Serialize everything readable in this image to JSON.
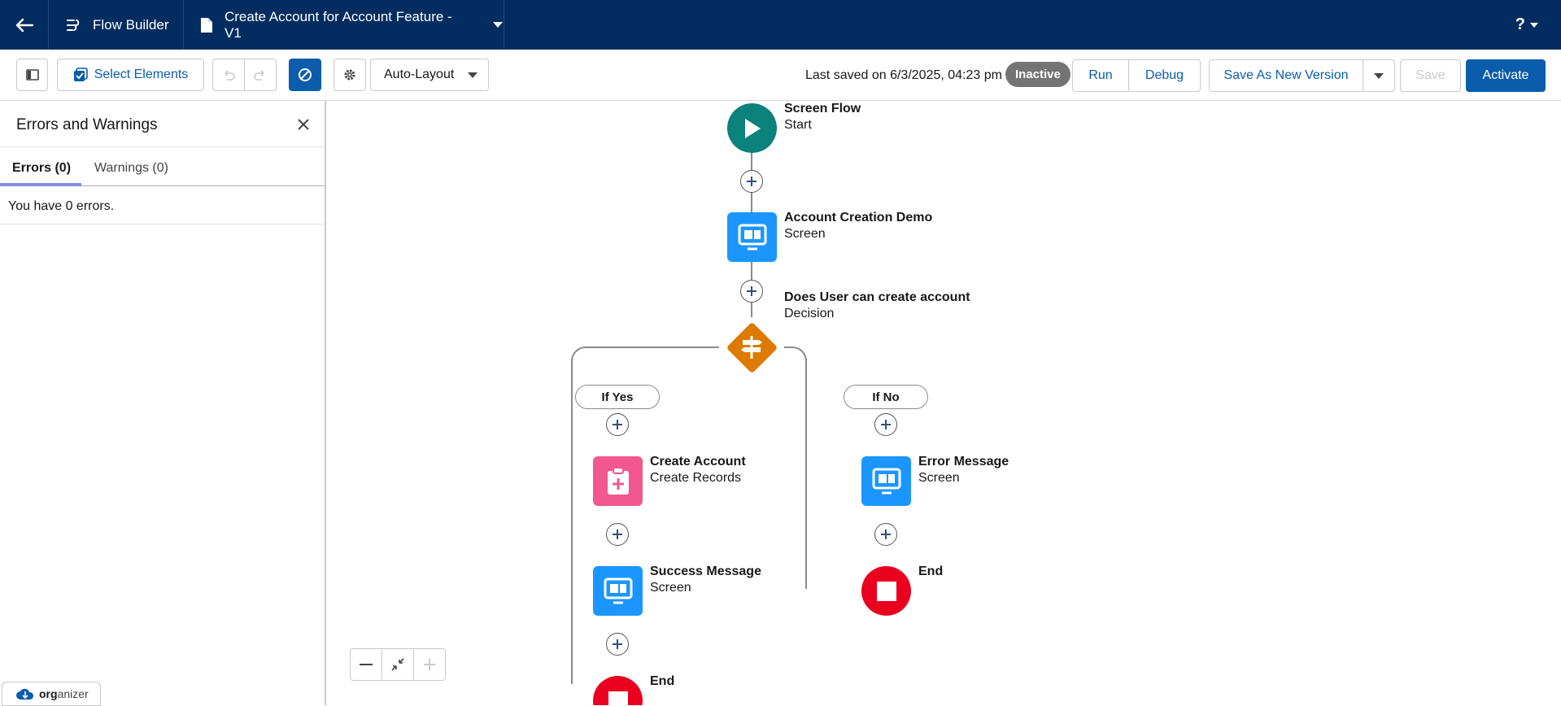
{
  "header": {
    "app_name": "Flow Builder",
    "file_title": "Create Account for Account Feature - V1",
    "help_label": "?"
  },
  "toolbar": {
    "select_elements_label": "Select Elements",
    "layout_mode": "Auto-Layout",
    "last_saved": "Last saved on 6/3/2025, 04:23 pm",
    "status_badge": "Inactive",
    "run_label": "Run",
    "debug_label": "Debug",
    "save_as_new_version_label": "Save As New Version",
    "save_label": "Save",
    "activate_label": "Activate"
  },
  "panel": {
    "title": "Errors and Warnings",
    "tabs": [
      {
        "label": "Errors (0)",
        "active": true
      },
      {
        "label": "Warnings (0)",
        "active": false
      }
    ],
    "message": "You have 0 errors."
  },
  "flow": {
    "start": {
      "title": "Screen Flow",
      "subtitle": "Start"
    },
    "screen1": {
      "title": "Account Creation Demo",
      "subtitle": "Screen"
    },
    "decision": {
      "title": "Does User can create account",
      "subtitle": "Decision"
    },
    "branch_yes": "If Yes",
    "branch_no": "If No",
    "create_account": {
      "title": "Create Account",
      "subtitle": "Create Records"
    },
    "error_message": {
      "title": "Error Message",
      "subtitle": "Screen"
    },
    "success_message": {
      "title": "Success Message",
      "subtitle": "Screen"
    },
    "end_right": {
      "title": "End"
    },
    "end_left": {
      "title": "End"
    }
  },
  "footer": {
    "organizer_bold": "org",
    "organizer_rest": "anizer"
  },
  "colors": {
    "header_bg": "#032d60",
    "brand_blue": "#0b5cab",
    "start_teal": "#0b827c",
    "screen_blue": "#1b96ff",
    "decision_orange": "#dd7a01",
    "create_pink": "#f2578e",
    "end_red": "#ea001e"
  }
}
